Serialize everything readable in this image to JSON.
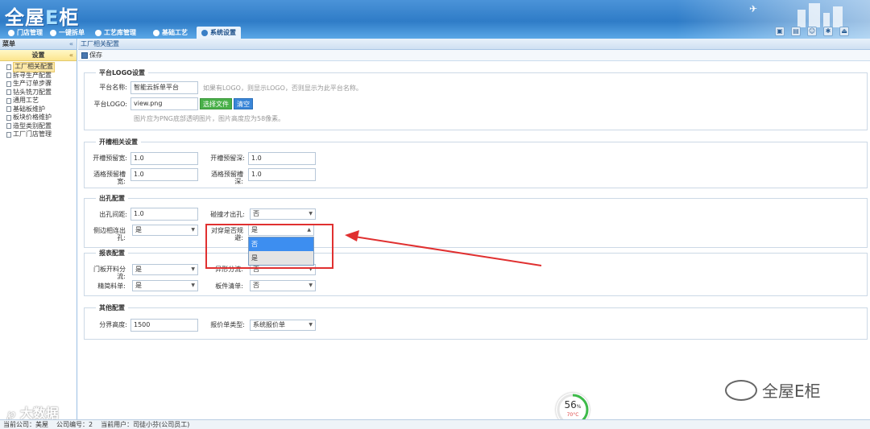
{
  "header": {
    "logo_main": "全屋",
    "logo_e": "E",
    "logo_tail": "柜"
  },
  "nav": {
    "items": [
      {
        "label": "门店管理"
      },
      {
        "label": "一键拆单"
      },
      {
        "label": "工艺库管理"
      },
      {
        "label": "基础工艺"
      },
      {
        "label": "系统设置"
      }
    ],
    "active_index": 4
  },
  "sidebar": {
    "title": "菜单",
    "collapse": "«",
    "section": "设置",
    "section_collapse": "«",
    "items": [
      {
        "label": "工厂相关配置"
      },
      {
        "label": "拆寻生产配置"
      },
      {
        "label": "生产订单步骤"
      },
      {
        "label": "钻头铣刀配置"
      },
      {
        "label": "通用工艺"
      },
      {
        "label": "基础板维护"
      },
      {
        "label": "板块价格维护"
      },
      {
        "label": "造型类别配置"
      },
      {
        "label": "工厂门店管理"
      }
    ]
  },
  "main": {
    "breadcrumb": "工厂相关配置",
    "save_label": "保存",
    "logo_section": {
      "legend": "平台LOGO设置",
      "name_label": "平台名称:",
      "name_value": "智能云拆单平台",
      "name_hint": "如果有LOGO，则显示LOGO，否则显示为此平台名称。",
      "logo_label": "平台LOGO:",
      "logo_value": "view.png",
      "choose_file": "选择文件",
      "clear": "清空",
      "logo_hint": "图片应为PNG底部透明图片，图片高度应为58像素。"
    },
    "groove_section": {
      "legend": "开槽相关设置",
      "width_label": "开槽预留宽:",
      "width_value": "1.0",
      "depth_label": "开槽预留深:",
      "depth_value": "1.0",
      "wine_width_label": "酒格预留槽宽:",
      "wine_width_value": "1.0",
      "wine_depth_label": "酒格预留槽深:",
      "wine_depth_value": "1.0"
    },
    "hole_section": {
      "legend": "出孔配置",
      "spacing_label": "出孔间距:",
      "spacing_value": "1.0",
      "collision_label": "碰撞才出孔:",
      "collision_value": "否",
      "side_label": "侧边相连出孔:",
      "side_value": "是",
      "through_label": "对穿是否规避:",
      "through_value": "是",
      "through_options": [
        "否",
        "是"
      ]
    },
    "report_section": {
      "legend": "报表配置",
      "door_label": "门板开料分流:",
      "door_value": "是",
      "shape_label": "异形分流:",
      "shape_value": "否",
      "fine_label": "精简料单:",
      "fine_value": "是",
      "board_label": "板件清单:",
      "board_value": "否"
    },
    "other_section": {
      "legend": "其他配置",
      "boundary_label": "分界高度:",
      "boundary_value": "1500",
      "quote_label": "报价单类型:",
      "quote_value": "系统报价单"
    }
  },
  "status": {
    "company": "当前公司：美屋",
    "company_no": "公司编号：2",
    "user": "当前用户：司徒小芬(公司员工)"
  },
  "overlay": {
    "gauge_percent": 56,
    "gauge_unit": "%",
    "gauge_temp": "70°C",
    "watermark_left": "大数据",
    "watermark_right": "全屋E柜"
  }
}
